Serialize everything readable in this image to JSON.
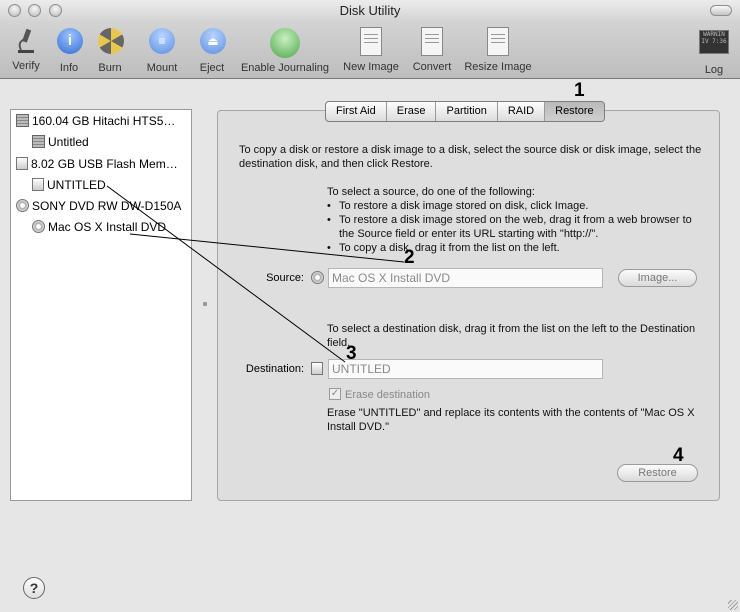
{
  "window": {
    "title": "Disk Utility"
  },
  "toolbar": {
    "items": [
      {
        "label": "Verify",
        "icon": "microscope-icon"
      },
      {
        "label": "Info",
        "icon": "info-icon"
      },
      {
        "label": "Burn",
        "icon": "burn-icon"
      },
      {
        "label": "Mount",
        "icon": "mount-icon"
      },
      {
        "label": "Eject",
        "icon": "eject-icon"
      },
      {
        "label": "Enable Journaling",
        "icon": "journaling-icon"
      },
      {
        "label": "New Image",
        "icon": "new-image-icon"
      },
      {
        "label": "Convert",
        "icon": "convert-icon"
      },
      {
        "label": "Resize Image",
        "icon": "resize-image-icon"
      },
      {
        "label": "Log",
        "icon": "log-icon"
      }
    ],
    "log_badge": "WARNIN\nIV 7:36"
  },
  "sidebar": {
    "items": [
      {
        "label": "160.04 GB Hitachi HTS5…",
        "type": "hard-disk"
      },
      {
        "label": "Untitled",
        "type": "volume"
      },
      {
        "label": "8.02 GB USB Flash Mem…",
        "type": "usb-disk"
      },
      {
        "label": "UNTITLED",
        "type": "volume"
      },
      {
        "label": "SONY DVD RW DW-D150A",
        "type": "optical-drive"
      },
      {
        "label": "Mac OS X Install DVD",
        "type": "optical-volume"
      }
    ]
  },
  "tabs": [
    "First Aid",
    "Erase",
    "Partition",
    "RAID",
    "Restore"
  ],
  "selected_tab": "Restore",
  "restore": {
    "intro": "To copy a disk or restore a disk image to a disk, select the source disk or disk image, select the destination disk, and then click Restore.",
    "source_instructions_title": "To select a source, do one of the following:",
    "source_bullets": [
      "To restore a disk image stored on disk, click Image.",
      "To restore a disk image stored on the web, drag it from a web browser to the Source field or enter its URL starting with \"http://\".",
      "To copy a disk, drag it from the list on the left."
    ],
    "source_label": "Source:",
    "source_value": "Mac OS X Install DVD",
    "image_button": "Image...",
    "destination_instructions": "To select a destination disk, drag it from the list on the left to the Destination field.",
    "destination_label": "Destination:",
    "destination_value": "UNTITLED",
    "erase_checkbox_label": "Erase destination",
    "erase_checked": true,
    "erase_warning": "Erase \"UNTITLED\" and replace its contents with the contents of \"Mac OS X Install DVD.\"",
    "restore_button": "Restore"
  },
  "callouts": [
    "1",
    "2",
    "3",
    "4"
  ],
  "help_button": "?"
}
